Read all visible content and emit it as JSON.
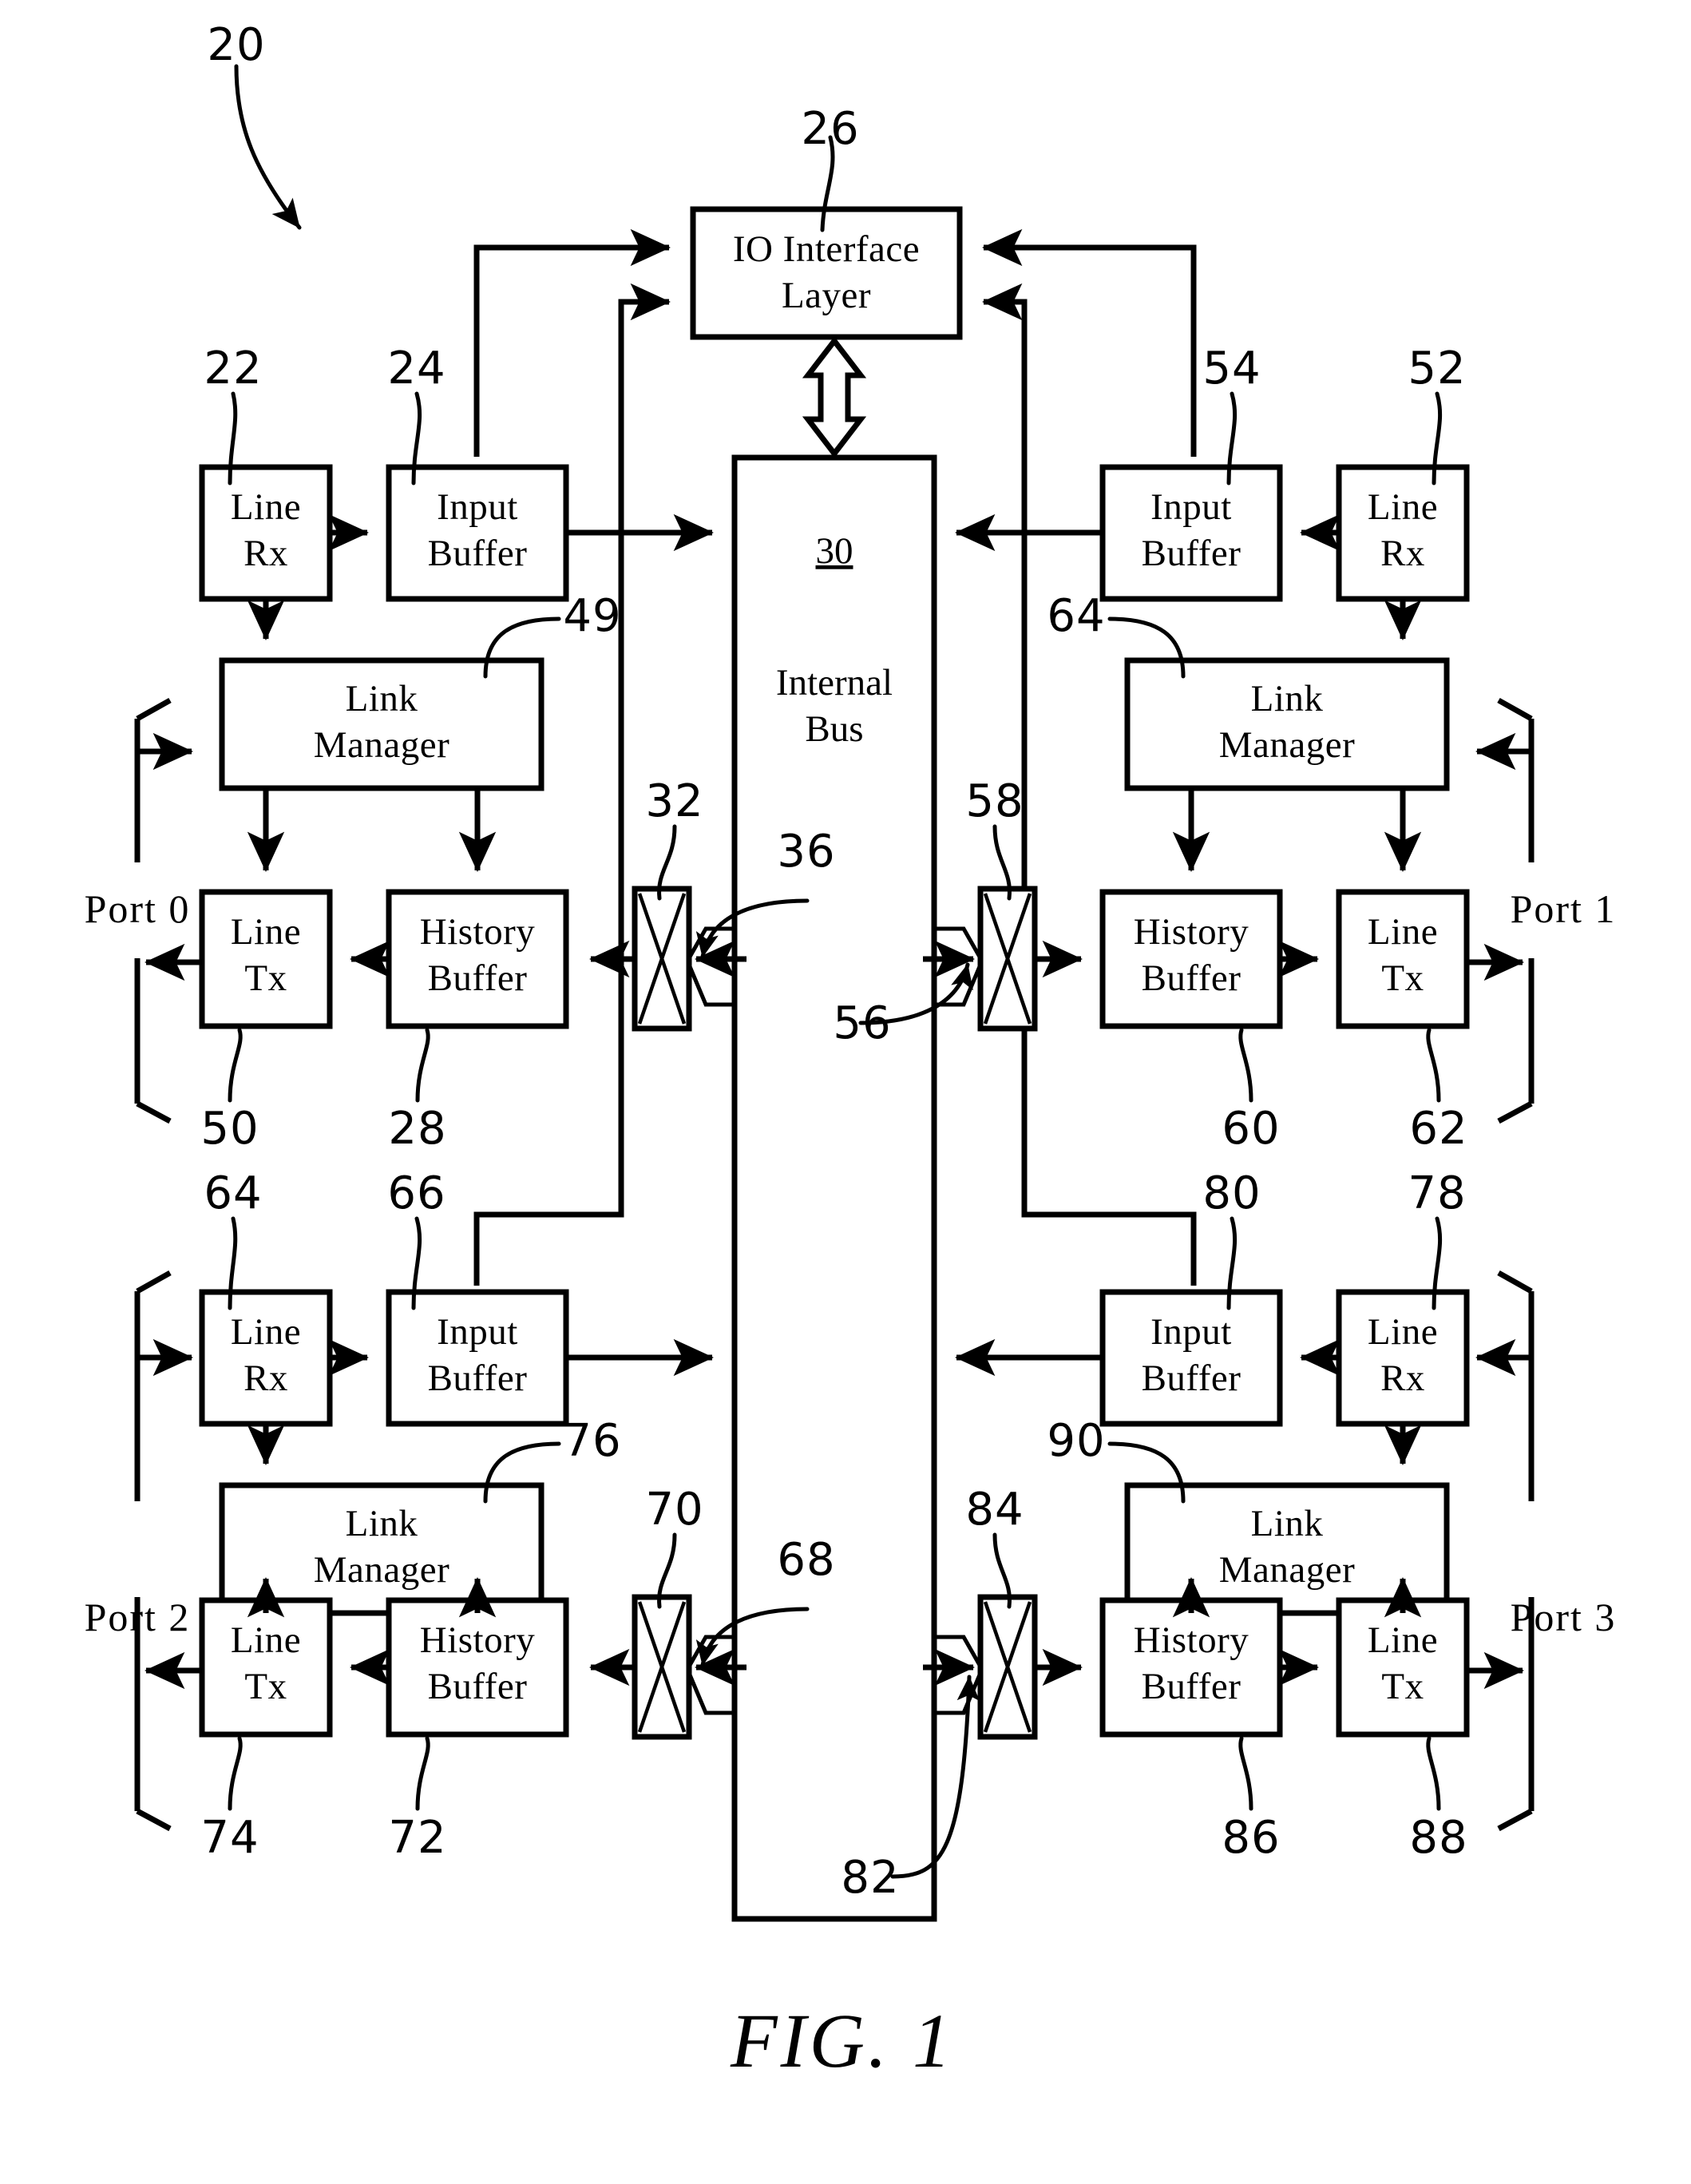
{
  "figure": {
    "caption": "FIG. 1",
    "system_ref": "20"
  },
  "blocks": {
    "io_interface": {
      "line1": "IO  Interface",
      "line2": "Layer",
      "ref": "26"
    },
    "internal_bus": {
      "ref_inline": "30",
      "line1": "Internal",
      "line2": "Bus"
    },
    "port0": {
      "name": "Port  0",
      "line_rx": {
        "line1": "Line",
        "line2": "Rx",
        "ref": "22"
      },
      "input_buffer": {
        "line1": "Input",
        "line2": "Buffer",
        "ref": "24"
      },
      "link_manager": {
        "line1": "Link",
        "line2": "Manager",
        "ref": "49"
      },
      "history_buffer": {
        "line1": "History",
        "line2": "Buffer",
        "ref": "28"
      },
      "line_tx": {
        "line1": "Line",
        "line2": "Tx",
        "ref": "50"
      },
      "crossbar": {
        "ref": "32"
      },
      "mux": {
        "ref": "36"
      }
    },
    "port1": {
      "name": "Port  1",
      "line_rx": {
        "line1": "Line",
        "line2": "Rx",
        "ref": "52"
      },
      "input_buffer": {
        "line1": "Input",
        "line2": "Buffer",
        "ref": "54"
      },
      "link_manager": {
        "line1": "Link",
        "line2": "Manager",
        "ref": "64"
      },
      "history_buffer": {
        "line1": "History",
        "line2": "Buffer",
        "ref": "60"
      },
      "line_tx": {
        "line1": "Line",
        "line2": "Tx",
        "ref": "62"
      },
      "crossbar": {
        "ref": "58"
      },
      "mux": {
        "ref": "56"
      }
    },
    "port2": {
      "name": "Port  2",
      "line_rx": {
        "line1": "Line",
        "line2": "Rx",
        "ref": "64"
      },
      "input_buffer": {
        "line1": "Input",
        "line2": "Buffer",
        "ref": "66"
      },
      "link_manager": {
        "line1": "Link",
        "line2": "Manager",
        "ref": "76"
      },
      "history_buffer": {
        "line1": "History",
        "line2": "Buffer",
        "ref": "72"
      },
      "line_tx": {
        "line1": "Line",
        "line2": "Tx",
        "ref": "74"
      },
      "crossbar": {
        "ref": "70"
      },
      "mux": {
        "ref": "68"
      }
    },
    "port3": {
      "name": "Port  3",
      "line_rx": {
        "line1": "Line",
        "line2": "Rx",
        "ref": "78"
      },
      "input_buffer": {
        "line1": "Input",
        "line2": "Buffer",
        "ref": "80"
      },
      "link_manager": {
        "line1": "Link",
        "line2": "Manager",
        "ref": "90"
      },
      "history_buffer": {
        "line1": "History",
        "line2": "Buffer",
        "ref": "86"
      },
      "line_tx": {
        "line1": "Line",
        "line2": "Tx",
        "ref": "88"
      },
      "crossbar": {
        "ref": "84"
      },
      "mux": {
        "ref": "82"
      }
    }
  }
}
